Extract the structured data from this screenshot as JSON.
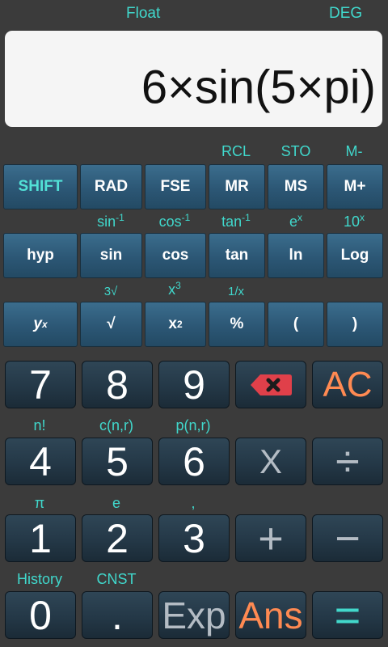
{
  "status": {
    "mode": "Float",
    "angle": "DEG"
  },
  "display": {
    "expression": "6×sin(5×pi)"
  },
  "row1": {
    "secondary": [
      "RCL",
      "STO",
      "M-"
    ],
    "buttons": [
      "SHIFT",
      "RAD",
      "FSE",
      "MR",
      "MS",
      "M+"
    ]
  },
  "row2": {
    "secondary": [
      {
        "base": "sin",
        "sup": "-1"
      },
      {
        "base": "cos",
        "sup": "-1"
      },
      {
        "base": "tan",
        "sup": "-1"
      },
      {
        "base": "e",
        "sup": "x"
      },
      {
        "base": "10",
        "sup": "x"
      }
    ],
    "buttons": [
      "hyp",
      "sin",
      "cos",
      "tan",
      "ln",
      "Log"
    ]
  },
  "row3": {
    "secondary": [
      {
        "base": "3√",
        "sup": ""
      },
      {
        "base": "x",
        "sup": "3"
      },
      {
        "base": "1/x",
        "sup": ""
      }
    ],
    "buttons": [
      {
        "base": "y",
        "sup": "x"
      },
      {
        "base": "√",
        "sup": ""
      },
      {
        "base": "x",
        "sup": "2"
      },
      {
        "base": "%",
        "sup": ""
      },
      {
        "base": "(",
        "sup": ""
      },
      {
        "base": ")",
        "sup": ""
      }
    ]
  },
  "keypad": {
    "row1": [
      "7",
      "8",
      "9",
      "backspace-icon",
      "AC"
    ],
    "row2_secondary": [
      "n!",
      "c(n,r)",
      "p(n,r)"
    ],
    "row2": [
      "4",
      "5",
      "6",
      "X",
      "÷"
    ],
    "row3_secondary": [
      "π",
      "e",
      ","
    ],
    "row3": [
      "1",
      "2",
      "3",
      "+",
      "−"
    ],
    "row4_secondary": [
      "History",
      "CNST"
    ],
    "row4": [
      "0",
      ".",
      "Exp",
      "Ans",
      "="
    ]
  },
  "colors": {
    "accent_teal": "#40d8cc",
    "ac_orange": "#ff8a52",
    "backspace_red": "#e0404a"
  }
}
